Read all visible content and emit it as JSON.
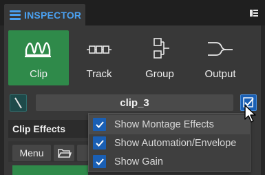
{
  "header": {
    "title": "INSPECTOR"
  },
  "modes": [
    {
      "label": "Clip",
      "icon": "waveform-icon",
      "active": true
    },
    {
      "label": "Track",
      "icon": "track-icon",
      "active": false
    },
    {
      "label": "Group",
      "icon": "group-icon",
      "active": false
    },
    {
      "label": "Output",
      "icon": "output-icon",
      "active": false
    }
  ],
  "clip": {
    "name": "clip_3"
  },
  "clip_effects": {
    "title": "Clip Effects",
    "menu_label": "Menu"
  },
  "popup": {
    "items": [
      {
        "label": "Show Montage Effects",
        "checked": true
      },
      {
        "label": "Show Automation/Envelope",
        "checked": true
      },
      {
        "label": "Show Gain",
        "checked": true
      }
    ]
  },
  "colors": {
    "accent": "#4aa0f0",
    "active_green": "#2f8a4a",
    "check_blue": "#1a5fb4"
  }
}
